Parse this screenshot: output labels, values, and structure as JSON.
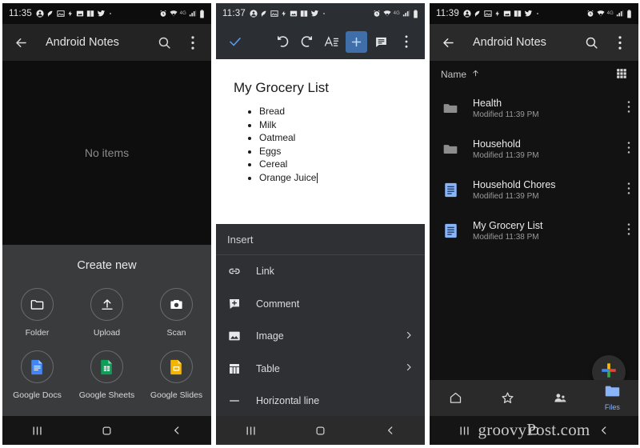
{
  "panels": [
    {
      "id": "panel-create-new",
      "status": {
        "time": "11:35",
        "icons": [
          "profile-icon",
          "pin-icon",
          "photo-icon",
          "flash-icon",
          "image-icon",
          "book-icon",
          "twitter-icon",
          "dot-icon"
        ],
        "right_icons": [
          "alarm-icon",
          "vpn-wifi-icon",
          "4g-icon",
          "signal-icon",
          "battery-icon"
        ]
      },
      "appbar": {
        "back_icon": "back-arrow-icon",
        "title": "Android Notes",
        "search_icon": "search-icon",
        "more_icon": "more-vert-icon"
      },
      "empty_message": "No items",
      "sheet": {
        "title": "Create new",
        "tiles": [
          {
            "label": "Folder",
            "icon": "folder-icon"
          },
          {
            "label": "Upload",
            "icon": "upload-icon"
          },
          {
            "label": "Scan",
            "icon": "camera-scan-icon"
          },
          {
            "label": "Google Docs",
            "icon": "google-docs-icon",
            "color": "#4285F4"
          },
          {
            "label": "Google Sheets",
            "icon": "google-sheets-icon",
            "color": "#0F9D58"
          },
          {
            "label": "Google Slides",
            "icon": "google-slides-icon",
            "color": "#F4B400"
          }
        ]
      },
      "navbar": [
        "recents-icon",
        "home-icon",
        "back-icon"
      ]
    },
    {
      "id": "panel-docs-editor",
      "status": {
        "time": "11:37",
        "icons": [
          "profile-icon",
          "pin-icon",
          "photo-icon",
          "flash-icon",
          "image-icon",
          "book-icon",
          "twitter-icon",
          "dot-icon"
        ],
        "right_icons": [
          "alarm-icon",
          "vpn-wifi-icon",
          "4g-icon",
          "signal-icon",
          "battery-icon"
        ]
      },
      "toolbar": [
        {
          "name": "done-check-button",
          "icon": "check-icon",
          "state": "accent"
        },
        {
          "name": "undo-button",
          "icon": "undo-icon",
          "state": "normal"
        },
        {
          "name": "redo-button",
          "icon": "redo-icon",
          "state": "normal"
        },
        {
          "name": "text-format-button",
          "icon": "text-format-icon",
          "state": "normal"
        },
        {
          "name": "insert-button",
          "icon": "plus-icon",
          "state": "active"
        },
        {
          "name": "comment-button",
          "icon": "comment-icon",
          "state": "normal"
        },
        {
          "name": "overflow-button",
          "icon": "more-vert-icon",
          "state": "normal"
        }
      ],
      "document": {
        "title": "My Grocery List",
        "items": [
          "Bread",
          "Milk",
          "Oatmeal",
          "Eggs",
          "Cereal",
          "Orange Juice"
        ],
        "caret_after": "Orange Juice"
      },
      "insert_menu": {
        "header": "Insert",
        "items": [
          {
            "label": "Link",
            "icon": "link-icon",
            "submenu": false
          },
          {
            "label": "Comment",
            "icon": "add-comment-icon",
            "submenu": false
          },
          {
            "label": "Image",
            "icon": "image-icon",
            "submenu": true
          },
          {
            "label": "Table",
            "icon": "table-icon",
            "submenu": true
          },
          {
            "label": "Horizontal line",
            "icon": "horizontal-line-icon",
            "submenu": false
          }
        ]
      },
      "navbar": [
        "recents-icon",
        "home-icon",
        "back-icon"
      ]
    },
    {
      "id": "panel-file-list",
      "status": {
        "time": "11:39",
        "icons": [
          "profile-icon",
          "pin-icon",
          "photo-icon",
          "flash-icon",
          "image-icon",
          "book-icon",
          "twitter-icon",
          "dot-icon"
        ],
        "right_icons": [
          "alarm-icon",
          "vpn-wifi-icon",
          "4g-icon",
          "signal-icon",
          "battery-icon"
        ]
      },
      "appbar": {
        "back_icon": "back-arrow-icon",
        "title": "Android Notes",
        "search_icon": "search-icon",
        "more_icon": "more-vert-icon"
      },
      "sortbar": {
        "label": "Name",
        "direction_icon": "arrow-up-icon",
        "grid_icon": "grid-view-icon"
      },
      "files": [
        {
          "name": "Health",
          "subtitle": "Modified 11:39 PM",
          "type": "folder"
        },
        {
          "name": "Household",
          "subtitle": "Modified 11:39 PM",
          "type": "folder"
        },
        {
          "name": "Household Chores",
          "subtitle": "Modified 11:39 PM",
          "type": "doc"
        },
        {
          "name": "My Grocery List",
          "subtitle": "Modified 11:38 PM",
          "type": "doc"
        }
      ],
      "fab": {
        "icon": "google-plus-icon",
        "colors": [
          "#4285F4",
          "#EA4335",
          "#FBBC05",
          "#34A853"
        ]
      },
      "bottomnav": [
        {
          "label": "",
          "icon": "home-icon",
          "active": false
        },
        {
          "label": "",
          "icon": "star-icon",
          "active": false
        },
        {
          "label": "",
          "icon": "shared-people-icon",
          "active": false
        },
        {
          "label": "Files",
          "icon": "files-folder-icon",
          "active": true
        }
      ],
      "navbar": [
        "recents-icon",
        "home-icon",
        "back-icon"
      ]
    }
  ],
  "watermark": "groovyPost.com",
  "colors": {
    "accent_blue": "#8ab4f8",
    "docs_blue": "#4285F4",
    "sheets_green": "#0F9D58",
    "slides_yellow": "#F4B400"
  }
}
